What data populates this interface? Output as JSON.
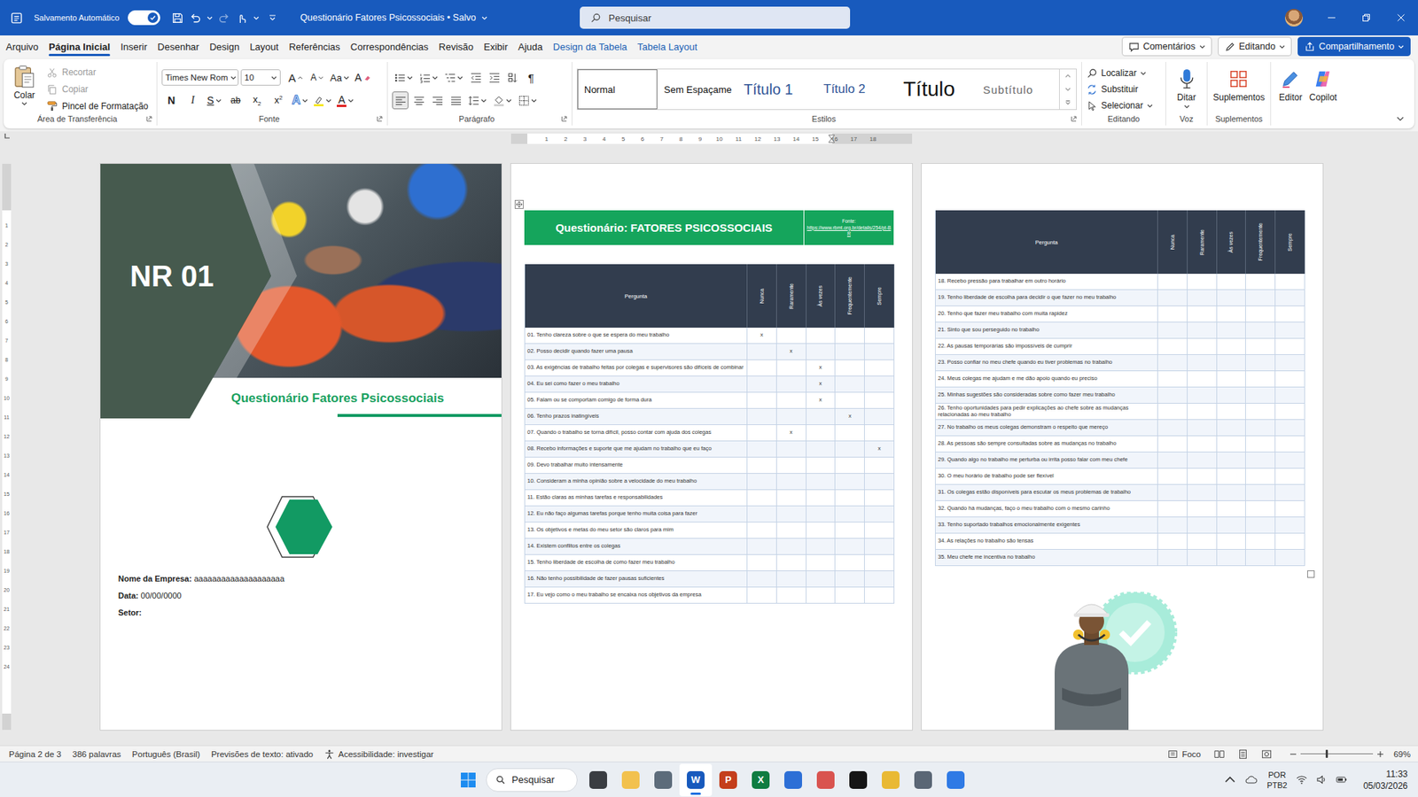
{
  "window": {
    "title": "Questionário Fatores Psicossociais • Salvo",
    "autosave": {
      "label": "Salvamento Automático",
      "on": true
    },
    "search": {
      "placeholder": "Pesquisar"
    }
  },
  "menu": {
    "tabs": [
      {
        "label": "Arquivo",
        "selected": false,
        "kind": "normal"
      },
      {
        "label": "Página Inicial",
        "selected": true,
        "kind": "normal"
      },
      {
        "label": "Inserir",
        "selected": false,
        "kind": "normal"
      },
      {
        "label": "Desenhar",
        "selected": false,
        "kind": "normal"
      },
      {
        "label": "Design",
        "selected": false,
        "kind": "normal"
      },
      {
        "label": "Layout",
        "selected": false,
        "kind": "normal"
      },
      {
        "label": "Referências",
        "selected": false,
        "kind": "normal"
      },
      {
        "label": "Correspondências",
        "selected": false,
        "kind": "normal"
      },
      {
        "label": "Revisão",
        "selected": false,
        "kind": "normal"
      },
      {
        "label": "Exibir",
        "selected": false,
        "kind": "normal"
      },
      {
        "label": "Ajuda",
        "selected": false,
        "kind": "normal"
      },
      {
        "label": "Design da Tabela",
        "selected": false,
        "kind": "contextual"
      },
      {
        "label": "Tabela Layout",
        "selected": false,
        "kind": "contextual"
      }
    ],
    "actions": [
      {
        "label": "Comentários",
        "kind": "comments"
      },
      {
        "label": "Editando",
        "kind": "mode"
      },
      {
        "label": "Compartilhamento",
        "kind": "share"
      }
    ]
  },
  "ribbon": {
    "clipboard": {
      "label": "Área de Transferência",
      "paste": "Colar",
      "items": [
        {
          "label": "Recortar",
          "kind": "cut",
          "disabled": true
        },
        {
          "label": "Copiar",
          "kind": "copy",
          "disabled": true
        },
        {
          "label": "Pincel de Formatação",
          "kind": "painter",
          "disabled": false
        }
      ]
    },
    "font": {
      "label": "Fonte",
      "family": "Times New Rom",
      "size": "10",
      "row1": [
        {
          "glyph": "A",
          "kind": "grow"
        },
        {
          "glyph": "A",
          "kind": "shrink"
        },
        {
          "glyph": "Aa",
          "kind": "case"
        },
        {
          "glyph": "A",
          "kind": "clear"
        }
      ],
      "row2": [
        {
          "glyph": "N",
          "kind": "bold"
        },
        {
          "glyph": "I",
          "kind": "italic"
        },
        {
          "glyph": "S",
          "kind": "underline"
        },
        {
          "glyph": "ab",
          "kind": "strike"
        },
        {
          "glyph": "x",
          "index": "2",
          "kind": "sub"
        },
        {
          "glyph": "x",
          "index": "2",
          "kind": "sup"
        },
        {
          "glyph": "A",
          "kind": "effects"
        },
        {
          "glyph": "",
          "kind": "highlight"
        },
        {
          "glyph": "A",
          "kind": "color"
        }
      ]
    },
    "paragraph": {
      "label": "Parágrafo",
      "pilcrow": "¶",
      "alignments": [
        {
          "kind": "left",
          "selected": true
        },
        {
          "kind": "center",
          "selected": false
        },
        {
          "kind": "right",
          "selected": false
        },
        {
          "kind": "justify",
          "selected": false
        }
      ]
    },
    "styles": {
      "label": "Estilos",
      "items": [
        {
          "label": "Normal",
          "kind": "normal",
          "selected": true
        },
        {
          "label": "Sem Espaçame",
          "kind": "normal",
          "selected": false
        },
        {
          "label": "Título 1",
          "kind": "h1",
          "selected": false
        },
        {
          "label": "Título 2",
          "kind": "h2",
          "selected": false
        },
        {
          "label": "Título",
          "kind": "title",
          "selected": false
        },
        {
          "label": "Subtítulo",
          "kind": "subtitle",
          "selected": false
        }
      ]
    },
    "editing": {
      "label": "Editando",
      "items": [
        {
          "label": "Localizar",
          "kind": "find",
          "dropdown": true
        },
        {
          "label": "Substituir",
          "kind": "replace",
          "dropdown": false
        },
        {
          "label": "Selecionar",
          "kind": "select",
          "dropdown": true
        }
      ]
    },
    "voice": {
      "label": "Voz",
      "button": "Ditar"
    },
    "addins": {
      "label": "Suplementos",
      "button": "Suplementos"
    },
    "tools": [
      {
        "label": "Editor",
        "kind": "editor"
      },
      {
        "label": "Copilot",
        "kind": "copilot"
      }
    ]
  },
  "ruler": {
    "marks": [
      "1",
      "2",
      "3",
      "4",
      "5",
      "6",
      "7",
      "8",
      "9",
      "10",
      "11",
      "12",
      "13",
      "14",
      "15",
      "16",
      "17",
      "18"
    ]
  },
  "vertical_ruler": {
    "marks": [
      "1",
      "2",
      "3",
      "4",
      "5",
      "6",
      "7",
      "8",
      "9",
      "10",
      "11",
      "12",
      "13",
      "14",
      "15",
      "16",
      "17",
      "18",
      "19",
      "20",
      "21",
      "22",
      "23",
      "24"
    ]
  },
  "cover": {
    "badge": "NR 01",
    "title": "Questionário Fatores Psicossociais",
    "fields": [
      {
        "label": "Nome da Empresa:",
        "value": "aaaaaaaaaaaaaaaaaaaa"
      },
      {
        "label": "Data:",
        "value": "00/00/0000"
      },
      {
        "label": "Setor:",
        "value": ""
      }
    ]
  },
  "questionnaire": {
    "title": "Questionário: FATORES PSICOSSOCIAIS",
    "source_label": "Fonte:",
    "source_url": "https://www.rbmt.org.br/details/254/pt-BR",
    "columns": [
      "Pergunta",
      "Nunca",
      "Raramente",
      "Às vezes",
      "Frequentemente",
      "Sempre"
    ],
    "pages": [
      {
        "rows": [
          {
            "text": "01. Tenho clareza sobre o que se espera do meu trabalho",
            "marks": [
              "x",
              "",
              "",
              "",
              ""
            ]
          },
          {
            "text": "02. Posso decidir quando fazer uma pausa",
            "marks": [
              "",
              "x",
              "",
              "",
              ""
            ]
          },
          {
            "text": "03. As exigências de trabalho feitas por colegas e supervisores são difíceis de combinar",
            "marks": [
              "",
              "",
              "x",
              "",
              ""
            ]
          },
          {
            "text": "04. Eu sei como fazer o meu trabalho",
            "marks": [
              "",
              "",
              "x",
              "",
              ""
            ]
          },
          {
            "text": "05. Falam ou se comportam comigo de forma dura",
            "marks": [
              "",
              "",
              "x",
              "",
              ""
            ]
          },
          {
            "text": "06. Tenho prazos inatingíveis",
            "marks": [
              "",
              "",
              "",
              "x",
              ""
            ]
          },
          {
            "text": "07. Quando o trabalho se torna difícil, posso contar com ajuda dos colegas",
            "marks": [
              "",
              "x",
              "",
              "",
              ""
            ]
          },
          {
            "text": "08. Recebo informações e suporte que me ajudam no trabalho que eu faço",
            "marks": [
              "",
              "",
              "",
              "",
              "x"
            ]
          },
          {
            "text": "09. Devo trabalhar muito intensamente",
            "marks": [
              "",
              "",
              "",
              "",
              ""
            ]
          },
          {
            "text": "10. Consideram a minha opinião sobre a velocidade do meu trabalho",
            "marks": [
              "",
              "",
              "",
              "",
              ""
            ]
          },
          {
            "text": "11. Estão claras as minhas tarefas e responsabilidades",
            "marks": [
              "",
              "",
              "",
              "",
              ""
            ]
          },
          {
            "text": "12. Eu não faço algumas tarefas porque tenho muita coisa para fazer",
            "marks": [
              "",
              "",
              "",
              "",
              ""
            ]
          },
          {
            "text": "13. Os objetivos e metas do meu setor são claros para mim",
            "marks": [
              "",
              "",
              "",
              "",
              ""
            ]
          },
          {
            "text": "14. Existem conflitos entre os colegas",
            "marks": [
              "",
              "",
              "",
              "",
              ""
            ]
          },
          {
            "text": "15. Tenho liberdade de escolha de como fazer meu trabalho",
            "marks": [
              "",
              "",
              "",
              "",
              ""
            ]
          },
          {
            "text": "16. Não tenho possibilidade de fazer pausas suficientes",
            "marks": [
              "",
              "",
              "",
              "",
              ""
            ]
          },
          {
            "text": "17. Eu vejo como o meu trabalho se encaixa nos objetivos da empresa",
            "marks": [
              "",
              "",
              "",
              "",
              ""
            ]
          }
        ]
      },
      {
        "rows": [
          {
            "text": "18. Recebo pressão para trabalhar em outro horário",
            "marks": [
              "",
              "",
              "",
              "",
              ""
            ]
          },
          {
            "text": "19. Tenho liberdade de escolha para decidir o que fazer no meu trabalho",
            "marks": [
              "",
              "",
              "",
              "",
              ""
            ]
          },
          {
            "text": "20. Tenho que fazer meu trabalho com muita rapidez",
            "marks": [
              "",
              "",
              "",
              "",
              ""
            ]
          },
          {
            "text": "21. Sinto que sou perseguido no trabalho",
            "marks": [
              "",
              "",
              "",
              "",
              ""
            ]
          },
          {
            "text": "22. As pausas temporárias são impossíveis de cumprir",
            "marks": [
              "",
              "",
              "",
              "",
              ""
            ]
          },
          {
            "text": "23. Posso confiar no meu chefe quando eu tiver problemas no trabalho",
            "marks": [
              "",
              "",
              "",
              "",
              ""
            ]
          },
          {
            "text": "24. Meus colegas me ajudam e me dão apoio quando eu preciso",
            "marks": [
              "",
              "",
              "",
              "",
              ""
            ]
          },
          {
            "text": "25. Minhas sugestões são consideradas sobre como fazer meu trabalho",
            "marks": [
              "",
              "",
              "",
              "",
              ""
            ]
          },
          {
            "text": "26. Tenho oportunidades para pedir explicações ao chefe sobre as mudanças relacionadas ao meu trabalho",
            "marks": [
              "",
              "",
              "",
              "",
              ""
            ]
          },
          {
            "text": "27. No trabalho os meus colegas demonstram o respeito que mereço",
            "marks": [
              "",
              "",
              "",
              "",
              ""
            ]
          },
          {
            "text": "28. As pessoas são sempre consultadas sobre as mudanças no trabalho",
            "marks": [
              "",
              "",
              "",
              "",
              ""
            ]
          },
          {
            "text": "29. Quando algo no trabalho me perturba ou irrita posso falar com meu chefe",
            "marks": [
              "",
              "",
              "",
              "",
              ""
            ]
          },
          {
            "text": "30. O meu horário de trabalho pode ser flexível",
            "marks": [
              "",
              "",
              "",
              "",
              ""
            ]
          },
          {
            "text": "31. Os colegas estão disponíveis para escutar os meus problemas de trabalho",
            "marks": [
              "",
              "",
              "",
              "",
              ""
            ]
          },
          {
            "text": "32. Quando há mudanças, faço o meu trabalho com o mesmo carinho",
            "marks": [
              "",
              "",
              "",
              "",
              ""
            ]
          },
          {
            "text": "33. Tenho suportado trabalhos emocionalmente exigentes",
            "marks": [
              "",
              "",
              "",
              "",
              ""
            ]
          },
          {
            "text": "34. As relações no trabalho são tensas",
            "marks": [
              "",
              "",
              "",
              "",
              ""
            ]
          },
          {
            "text": "35. Meu chefe me incentiva no trabalho",
            "marks": [
              "",
              "",
              "",
              "",
              ""
            ]
          }
        ]
      }
    ]
  },
  "status_bar": {
    "page": "Página 2 de 3",
    "words": "386 palavras",
    "language": "Português (Brasil)",
    "predictions": "Previsões de texto: ativado",
    "accessibility": "Acessibilidade: investigar",
    "focus": "Foco",
    "zoom": {
      "level": 0.36,
      "reading": "69%"
    }
  },
  "taskbar": {
    "search": "Pesquisar",
    "apps": [
      {
        "glyph": "",
        "color": "#3a3d42",
        "selected": false
      },
      {
        "glyph": "",
        "color": "#f2c14e",
        "selected": false
      },
      {
        "glyph": "",
        "color": "#5c6b7a",
        "selected": false
      },
      {
        "glyph": "W",
        "color": "#185abd",
        "selected": true
      },
      {
        "glyph": "P",
        "color": "#c43e1c",
        "selected": false
      },
      {
        "glyph": "X",
        "color": "#107c41",
        "selected": false
      },
      {
        "glyph": "",
        "color": "#2d6fd6",
        "selected": false
      },
      {
        "glyph": "",
        "color": "#d9534f",
        "selected": false
      },
      {
        "glyph": "",
        "color": "#151515",
        "selected": false
      },
      {
        "glyph": "",
        "color": "#e9b934",
        "selected": false
      },
      {
        "glyph": "",
        "color": "#5a6675",
        "selected": false
      },
      {
        "glyph": "",
        "color": "#2f7ae5",
        "selected": false
      }
    ],
    "tray": {
      "lang": "POR",
      "layout": "PTB2",
      "time": "11:33",
      "date": "05/03/2026"
    }
  }
}
